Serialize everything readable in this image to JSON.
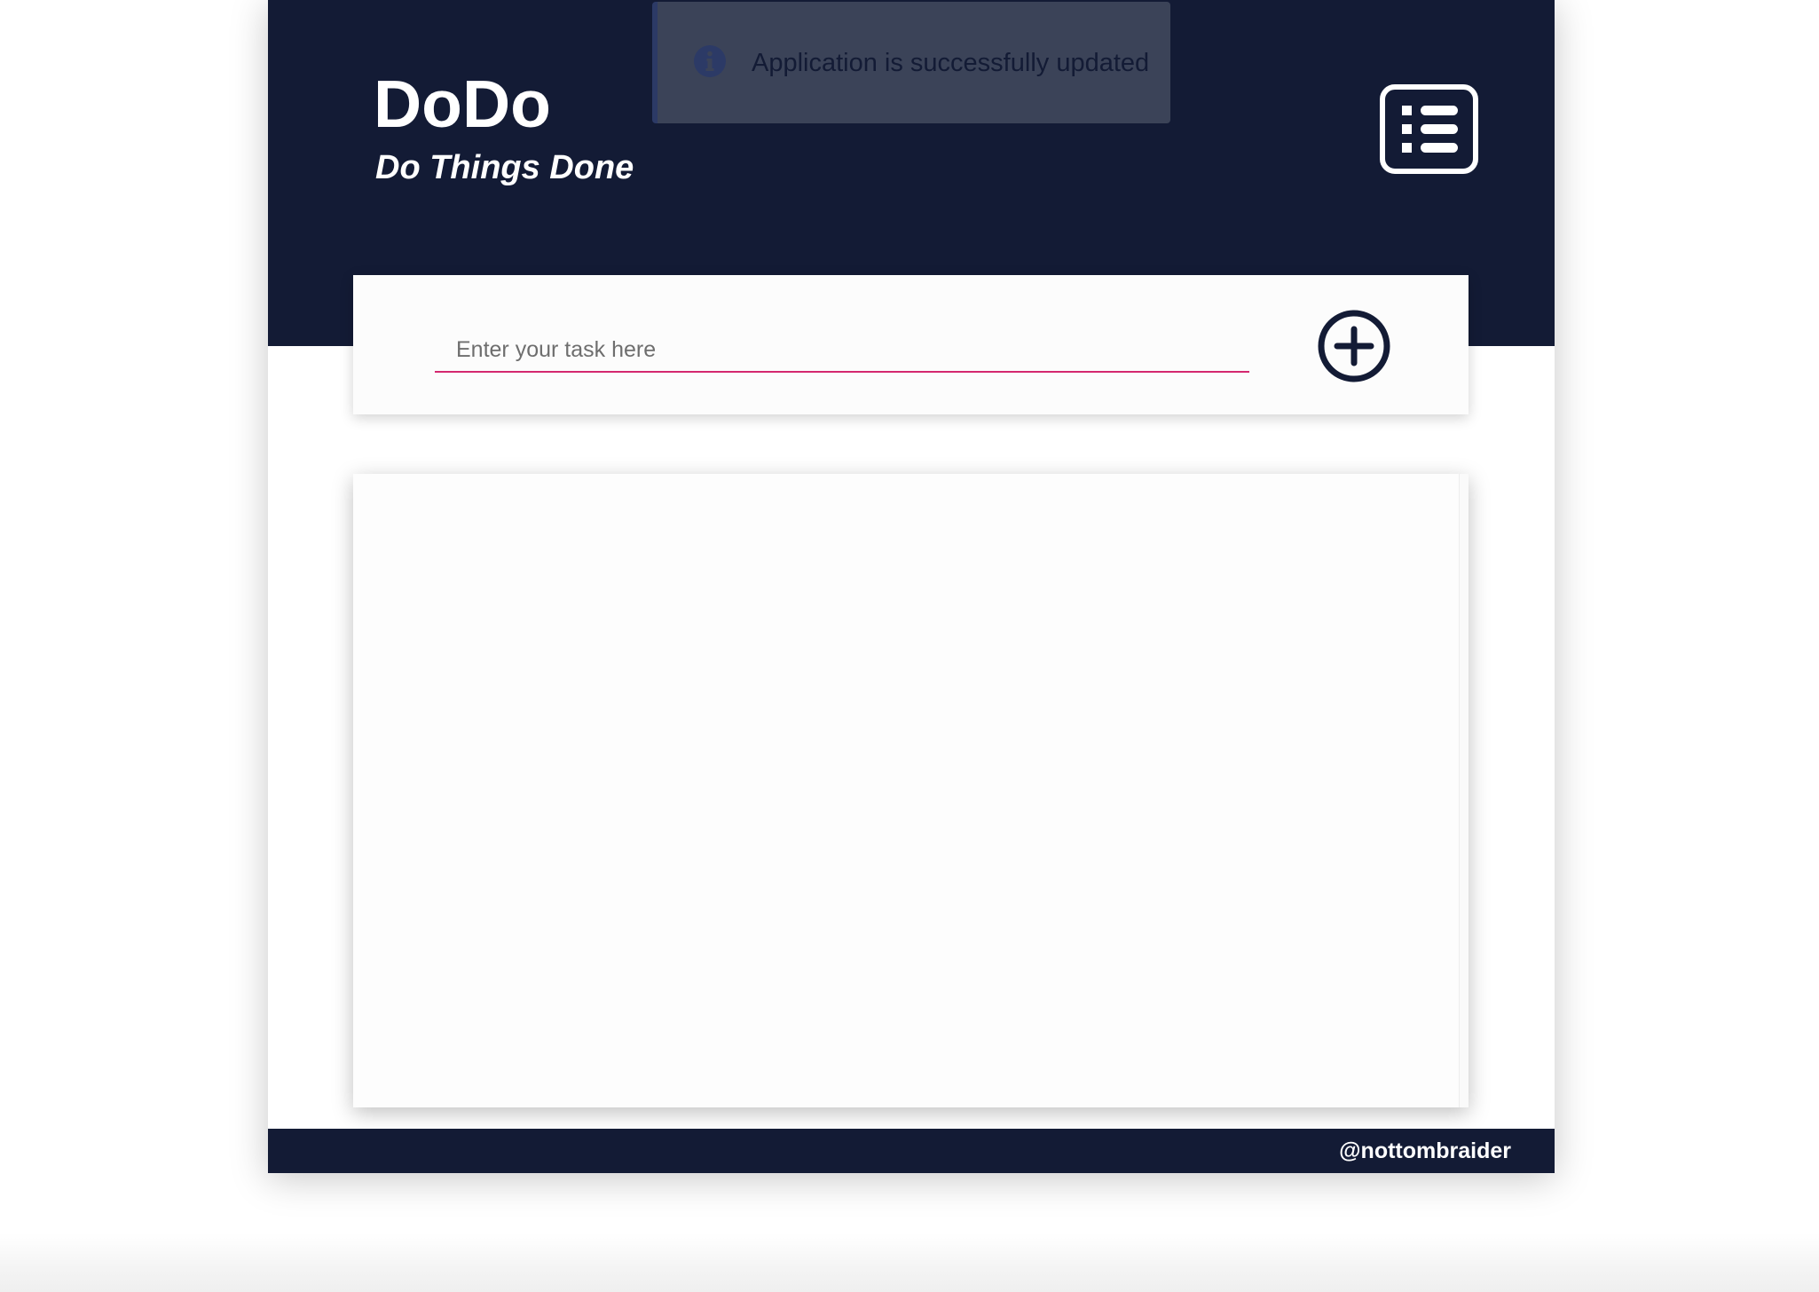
{
  "app": {
    "title": "DoDo",
    "subtitle": "Do Things Done"
  },
  "header": {
    "menu_icon": "list-icon"
  },
  "notification": {
    "icon": "info-icon",
    "message": "Application is successfully updated"
  },
  "task_form": {
    "placeholder": "Enter your task here",
    "value": "",
    "add_icon": "plus-circle-icon"
  },
  "task_list": {
    "items": []
  },
  "footer": {
    "credit": "@nottombraider"
  },
  "colors": {
    "navy": "#131b35",
    "accent_underline": "#d4286f",
    "toast_bg": "#3b4358",
    "toast_icon": "#2c3a66"
  }
}
